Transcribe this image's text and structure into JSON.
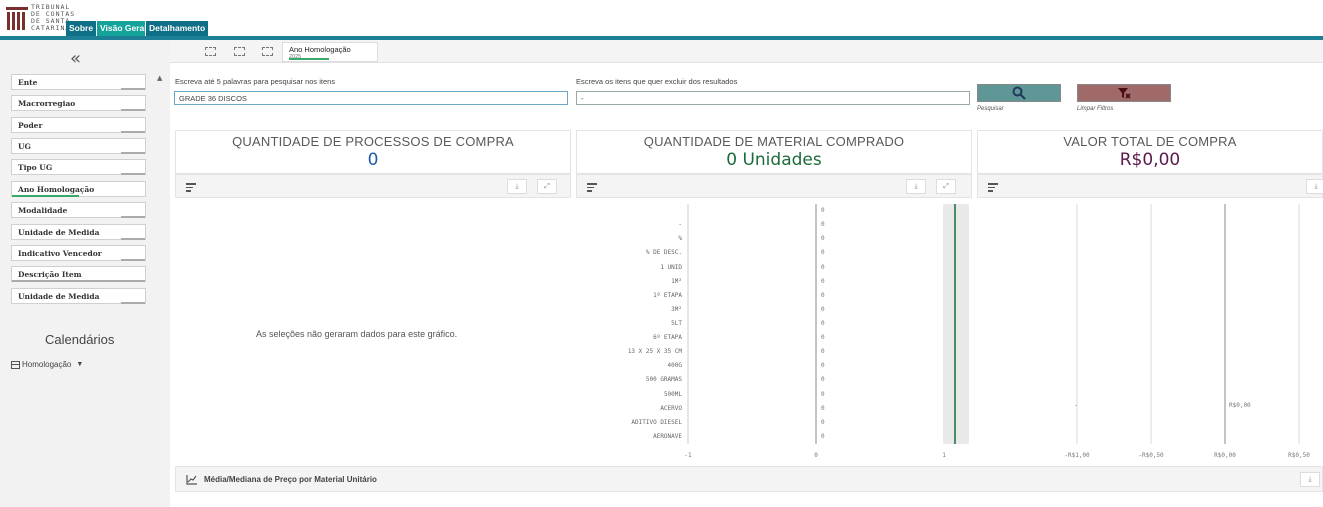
{
  "header": {
    "logo_lines": [
      "TRIBUNAL",
      "DE CONTAS",
      "DE SANTA",
      "CATARINA"
    ],
    "tabs": [
      {
        "label": "Sobre"
      },
      {
        "label": "Visão Geral"
      },
      {
        "label": "Detalhamento"
      }
    ]
  },
  "sidebar": {
    "collapse_glyph": "«",
    "filters": [
      {
        "label": "Ente",
        "selection_fraction": 0
      },
      {
        "label": "Macrorregiao",
        "selection_fraction": 0
      },
      {
        "label": "Poder",
        "selection_fraction": 0
      },
      {
        "label": "UG",
        "selection_fraction": 0
      },
      {
        "label": "Tipo UG",
        "selection_fraction": 0
      },
      {
        "label": "Ano Homologação",
        "selection_fraction": 0.5
      },
      {
        "label": "Modalidade",
        "selection_fraction": 0
      },
      {
        "label": "Unidade de Medida",
        "selection_fraction": 0
      },
      {
        "label": "Indicativo Vencedor",
        "selection_fraction": 0
      },
      {
        "label": "Descrição Item",
        "selection_fraction": 0
      },
      {
        "label": "Unidade de Medida",
        "selection_fraction": 0
      }
    ],
    "calendar_title": "Calendários",
    "calendar_item": "Homologação"
  },
  "toolbar": {
    "selection_chip": {
      "title": "Ano Homologação",
      "value": "2025"
    }
  },
  "search": {
    "include_label": "Escreva até 5 palavras para pesquisar nos itens",
    "include_value": "GRADE 36 DISCOS",
    "exclude_label": "Escreva os itens que quer excluir dos resultados",
    "exclude_value": "-",
    "search_button_caption": "Pesquisar",
    "clear_button_caption": "Limpar Filtros"
  },
  "kpis": [
    {
      "title": "QUANTIDADE DE PROCESSOS DE COMPRA",
      "value": "0",
      "color": "#1f5aa6"
    },
    {
      "title": "QUANTIDADE DE MATERIAL COMPRADO",
      "value": "0 Unidades",
      "color": "#1d6b3a"
    },
    {
      "title": "VALOR TOTAL DE COMPRA",
      "value": "R$0,00",
      "color": "#5a1a4a"
    }
  ],
  "panels": {
    "no_data_message": "As seleções não geraram dados para este gráfico."
  },
  "chart_data": [
    {
      "type": "bar",
      "orientation": "horizontal",
      "categories": [
        "",
        "-",
        "%",
        "% DE DESC.",
        "1 UNID",
        "1M²",
        "1º ETAPA",
        "3M²",
        "5LT",
        "6º ETAPA",
        "13 X 25 X 35 CM",
        "400G",
        "500 GRAMAS",
        "500ML",
        "ACERVO",
        "ADITIVO DIESEL",
        "AERONAVE"
      ],
      "values": [
        0,
        0,
        0,
        0,
        0,
        0,
        0,
        0,
        0,
        0,
        0,
        0,
        0,
        0,
        0,
        0,
        0
      ],
      "data_labels": [
        "0",
        "0",
        "0",
        "0",
        "0",
        "0",
        "0",
        "0",
        "0",
        "0",
        "0",
        "0",
        "0",
        "0",
        "0",
        "0",
        "0"
      ],
      "xlim": [
        -1,
        1
      ],
      "xticks": [
        "-1",
        "0",
        "1"
      ]
    },
    {
      "type": "bar",
      "orientation": "horizontal",
      "categories": [
        "-"
      ],
      "values": [
        0
      ],
      "data_labels": [
        "R$0,00"
      ],
      "xlim": [
        -1,
        0.5
      ],
      "xticks": [
        "-R$1,00",
        "-R$0,50",
        "R$0,00",
        "R$0,50"
      ]
    }
  ],
  "bottom_panel": {
    "title": "Média/Mediana de Preço por Material Unitário"
  }
}
